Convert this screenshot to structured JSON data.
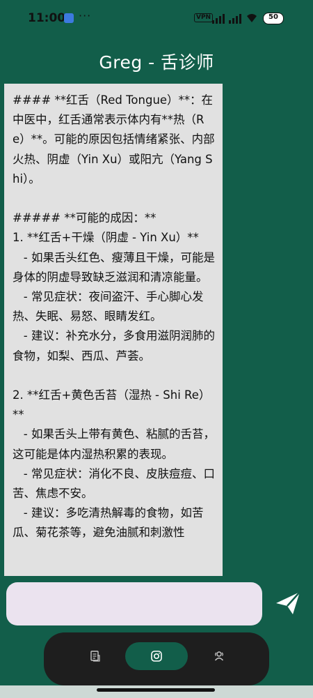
{
  "status_bar": {
    "time": "11:00",
    "notification_dots": "···",
    "vpn_label": "VPN",
    "battery_level": "50"
  },
  "header": {
    "title": "Greg - 舌诊师"
  },
  "chat": {
    "message": "#### **红舌（Red Tongue）**：在中医中，红舌通常表示体内有**热（Re）**。可能的原因包括情绪紧张、内部火热、阴虚（Yin Xu）或阳亢（Yang Shi）。\n\n##### **可能的成因：**\n1. **红舌+干燥（阴虚 - Yin Xu）**\n   - 如果舌头红色、瘦薄且干燥，可能是身体的阴虚导致缺乏滋润和清凉能量。\n   - 常见症状：夜间盗汗、手心脚心发热、失眠、易怒、眼睛发红。\n   - 建议：补充水分，多食用滋阴润肺的食物，如梨、西瓜、芦荟。\n\n2. **红舌+黄色舌苔（湿热 - Shi Re）**\n   - 如果舌头上带有黄色、粘腻的舌苔，这可能是体内湿热积累的表现。\n   - 常见症状：消化不良、皮肤痘痘、口苦、焦虑不安。\n   - 建议：多吃清热解毒的食物，如苦瓜、菊花茶等，避免油腻和刺激性"
  },
  "input": {
    "value": "",
    "placeholder": ""
  },
  "icons": {
    "send": "send-icon",
    "nav_history": "document-icon",
    "nav_camera": "instagram-camera-icon",
    "nav_profile": "users-icon"
  },
  "colors": {
    "background": "#125e4a",
    "card": "#e1e1e1",
    "input": "#ebe3ef",
    "nav_bar": "#1e1e1e",
    "nav_active": "#125e4a"
  }
}
